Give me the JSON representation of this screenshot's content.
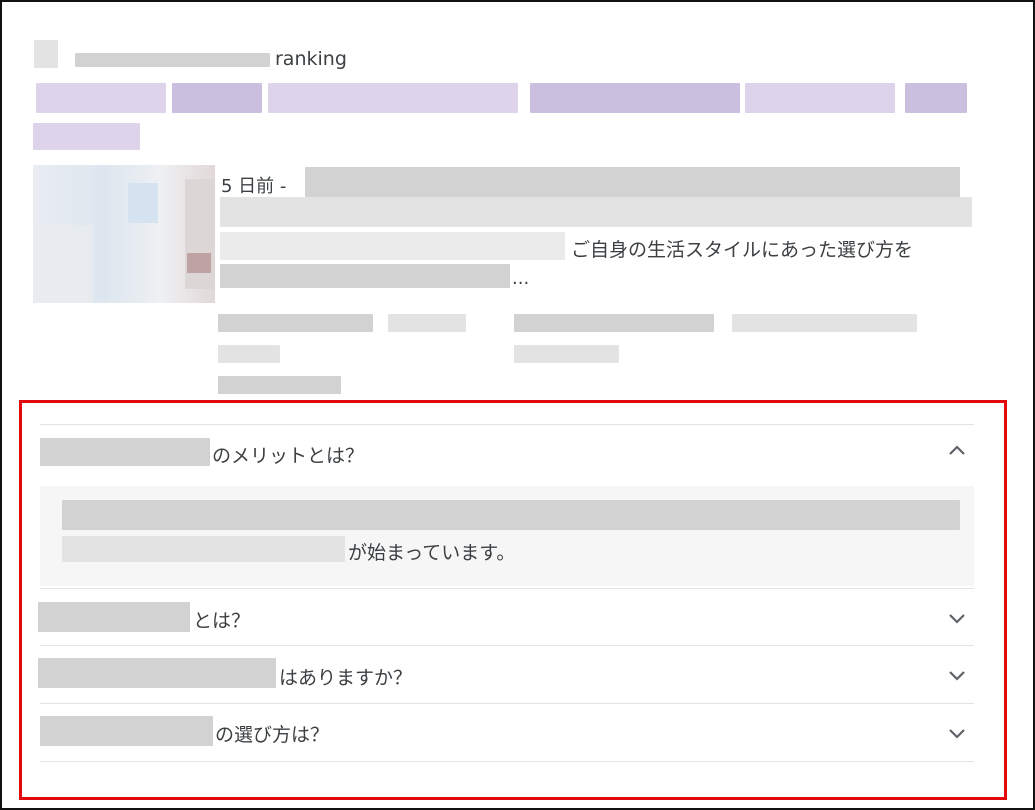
{
  "result": {
    "site_suffix": "ranking",
    "date": "5 日前 -",
    "snippet_visible": "ご自身の生活スタイルにあった選び方を",
    "ellipsis": "..."
  },
  "faq": {
    "items": [
      {
        "question_suffix": "のメリットとは？",
        "expanded": true,
        "answer_suffix": "が始まっています。"
      },
      {
        "question_suffix": "とは？",
        "expanded": false
      },
      {
        "question_suffix": "はありますか？",
        "expanded": false
      },
      {
        "question_suffix": "の選び方は？",
        "expanded": false
      }
    ]
  },
  "icons": {
    "expanded": "chevron-up-icon",
    "collapsed": "chevron-down-icon"
  },
  "colors": {
    "highlight_border": "#e0090b",
    "link_blur": "#cbbfdf",
    "answer_bg": "#f6f6f6"
  }
}
